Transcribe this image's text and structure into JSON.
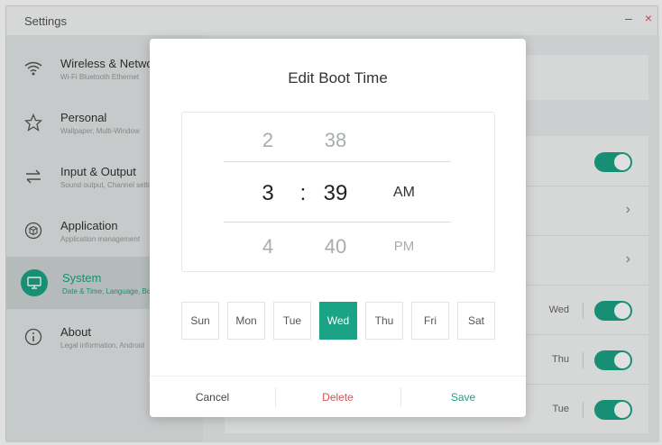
{
  "window": {
    "title": "Settings",
    "minimize": "–",
    "close": "×"
  },
  "sidebar": {
    "items": [
      {
        "title": "Wireless & Network",
        "subtitle": "Wi-Fi Bluetooth Ethernet",
        "icon": "wifi-icon"
      },
      {
        "title": "Personal",
        "subtitle": "Wallpaper, Multi-Window",
        "icon": "star-icon"
      },
      {
        "title": "Input & Output",
        "subtitle": "Sound output, Channel settings",
        "icon": "input-output-icon"
      },
      {
        "title": "Application",
        "subtitle": "Application management",
        "icon": "cube-icon"
      },
      {
        "title": "System",
        "subtitle": "Date & Time, Language, Boot",
        "icon": "monitor-icon",
        "active": true
      },
      {
        "title": "About",
        "subtitle": "Legal information, Android",
        "icon": "info-icon"
      }
    ]
  },
  "background_rows": {
    "tags": [
      "Wed",
      "Thu",
      "Tue"
    ]
  },
  "dialog": {
    "title": "Edit Boot Time",
    "picker": {
      "hour_prev": "2",
      "hour_sel": "3",
      "hour_next": "4",
      "separator": ":",
      "min_prev": "38",
      "min_sel": "39",
      "min_next": "40",
      "ampm_sel": "AM",
      "ampm_next": "PM"
    },
    "days": [
      {
        "label": "Sun",
        "selected": false
      },
      {
        "label": "Mon",
        "selected": false
      },
      {
        "label": "Tue",
        "selected": false
      },
      {
        "label": "Wed",
        "selected": true
      },
      {
        "label": "Thu",
        "selected": false
      },
      {
        "label": "Fri",
        "selected": false
      },
      {
        "label": "Sat",
        "selected": false
      }
    ],
    "buttons": {
      "cancel": "Cancel",
      "delete": "Delete",
      "save": "Save"
    }
  },
  "colors": {
    "accent": "#1aa385",
    "delete": "#d9534f",
    "save": "#1aa385"
  }
}
